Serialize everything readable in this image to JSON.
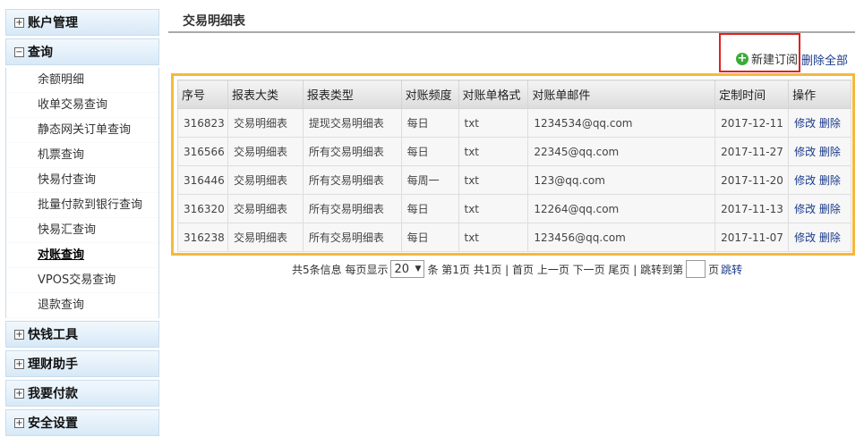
{
  "sidebar": {
    "sections": [
      {
        "toggle": "⊞",
        "title": "账户管理"
      },
      {
        "toggle": "⊟",
        "title": "查询"
      },
      {
        "toggle": "⊞",
        "title": "快钱工具"
      },
      {
        "toggle": "⊞",
        "title": "理财助手"
      },
      {
        "toggle": "⊞",
        "title": "我要付款"
      },
      {
        "toggle": "⊞",
        "title": "安全设置"
      }
    ],
    "query_items": [
      "余额明细",
      "收单交易查询",
      "静态网关订单查询",
      "机票查询",
      "快易付查询",
      "批量付款到银行查询",
      "快易汇查询",
      "对账查询",
      "VPOS交易查询",
      "退款查询"
    ]
  },
  "main": {
    "title": "交易明细表",
    "new_subscription": "新建订阅",
    "delete_all": "删除全部"
  },
  "table": {
    "headers": [
      "序号",
      "报表大类",
      "报表类型",
      "对账频度",
      "对账单格式",
      "对账单邮件",
      "定制时间",
      "操作"
    ],
    "rows": [
      [
        "316823",
        "交易明细表",
        "提现交易明细表",
        "每日",
        "txt",
        "1234534@qq.com",
        "2017-12-11"
      ],
      [
        "316566",
        "交易明细表",
        "所有交易明细表",
        "每日",
        "txt",
        "22345@qq.com",
        "2017-11-27"
      ],
      [
        "316446",
        "交易明细表",
        "所有交易明细表",
        "每周一",
        "txt",
        "123@qq.com",
        "2017-11-20"
      ],
      [
        "316320",
        "交易明细表",
        "所有交易明细表",
        "每日",
        "txt",
        "12264@qq.com",
        "2017-11-13"
      ],
      [
        "316238",
        "交易明细表",
        "所有交易明细表",
        "每日",
        "txt",
        "123456@qq.com",
        "2017-11-07"
      ]
    ],
    "edit_label": "修改",
    "delete_label": "删除"
  },
  "pagination": {
    "info_prefix": "共5条信息 每页显示",
    "page_size": "20",
    "info_suffix": "条 第1页 共1页 | 首页 上一页 下一页 尾页 | 跳转到第",
    "page_unit": "页",
    "jump": "跳转"
  }
}
